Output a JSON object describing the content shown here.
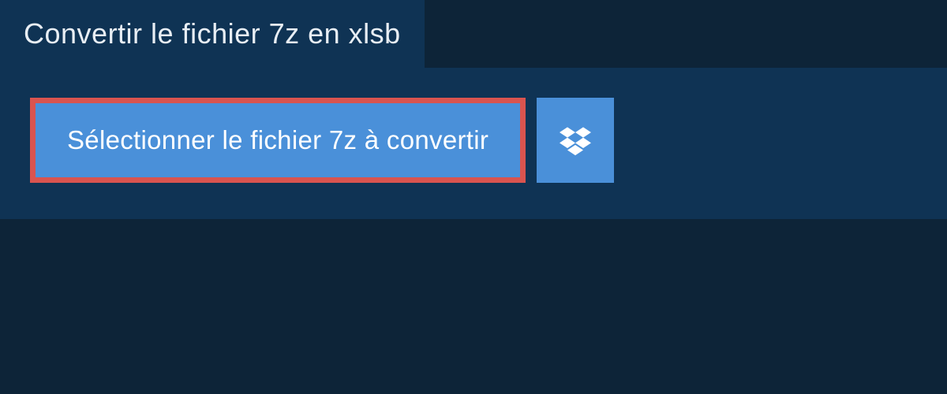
{
  "header": {
    "title": "Convertir le fichier 7z en xlsb"
  },
  "upload": {
    "select_label": "Sélectionner le fichier 7z à convertir"
  }
}
